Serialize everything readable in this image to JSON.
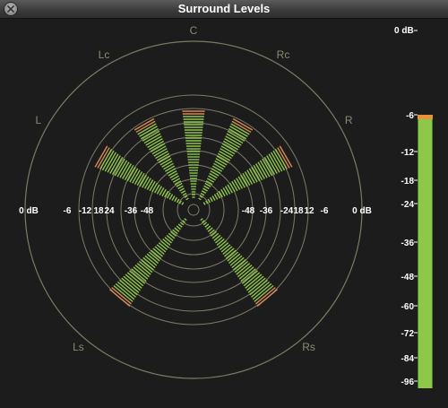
{
  "window": {
    "title": "Surround Levels"
  },
  "channels": [
    {
      "name": "L",
      "angle": -60,
      "level": 0.93
    },
    {
      "name": "Lc",
      "angle": -30,
      "level": 0.86
    },
    {
      "name": "C",
      "angle": 0,
      "level": 0.88
    },
    {
      "name": "Rc",
      "angle": 30,
      "level": 0.86
    },
    {
      "name": "R",
      "angle": 60,
      "level": 0.93
    },
    {
      "name": "Ls",
      "angle": -140,
      "level": 1.0
    },
    {
      "name": "Rs",
      "angle": 140,
      "level": 1.0
    }
  ],
  "radial_scale": {
    "left_labels": [
      "0 dB",
      "-6",
      "-12",
      "18",
      "24",
      "-36",
      "-48"
    ],
    "right_labels": [
      "-48",
      "-36",
      "-24",
      "18",
      "12",
      "-6",
      "0 dB"
    ]
  },
  "master_meter": {
    "top_label": "0 dB",
    "ticks": [
      "-6",
      "-12",
      "-18",
      "-24",
      "-36",
      "-48",
      "-60",
      "-72",
      "-84",
      "-96"
    ],
    "level_db": -6
  },
  "colors": {
    "background": "#1c1c1c",
    "ring": "#7d7b66",
    "meter_green": "#8fc74a",
    "meter_peak": "#d88a55",
    "label_gray": "#8b8a72"
  }
}
